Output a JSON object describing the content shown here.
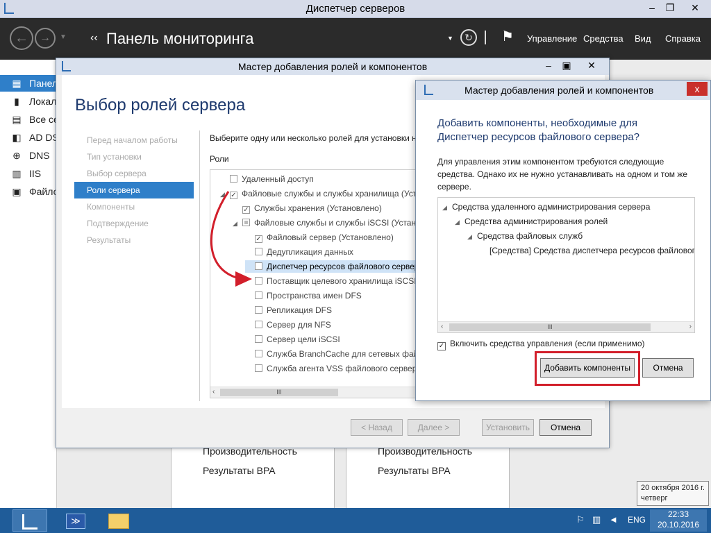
{
  "server_manager": {
    "title": "Диспетчер серверов",
    "header_title": "Панель мониторинга",
    "header_prefix": "‹‹",
    "menu": [
      "Управление",
      "Средства",
      "Вид",
      "Справка"
    ],
    "sidebar": [
      {
        "label": "Панель",
        "icon": "dashboard-icon",
        "glyph": "▦",
        "active": true
      },
      {
        "label": "Локал",
        "icon": "local-server-icon",
        "glyph": "▮"
      },
      {
        "label": "Все се",
        "icon": "all-servers-icon",
        "glyph": "▤"
      },
      {
        "label": "AD DS",
        "icon": "ad-ds-icon",
        "glyph": "◧"
      },
      {
        "label": "DNS",
        "icon": "dns-icon",
        "glyph": "⊕"
      },
      {
        "label": "IIS",
        "icon": "iis-icon",
        "glyph": "▥"
      },
      {
        "label": "Файло",
        "icon": "file-services-icon",
        "glyph": "▣"
      }
    ],
    "tiles": [
      {
        "performance": "Производительность",
        "bpa": "Результаты BPA"
      },
      {
        "performance": "Производительность",
        "bpa": "Результаты BPA"
      }
    ]
  },
  "wizard": {
    "title": "Мастер добавления ролей и компонентов",
    "heading": "Выбор ролей сервера",
    "steps": [
      {
        "label": "Перед началом работы",
        "active": false
      },
      {
        "label": "Тип установки",
        "active": false
      },
      {
        "label": "Выбор сервера",
        "active": false
      },
      {
        "label": "Роли сервера",
        "active": true
      },
      {
        "label": "Компоненты",
        "active": false
      },
      {
        "label": "Подтверждение",
        "active": false
      },
      {
        "label": "Результаты",
        "active": false
      }
    ],
    "description": "Выберите одну или несколько ролей для установки на",
    "roles_label": "Роли",
    "roles": [
      {
        "label": "Удаленный доступ",
        "checked": false,
        "indent": 0,
        "expand": ""
      },
      {
        "label": "Файловые службы и службы хранилища (Устан",
        "checked": true,
        "indent": 0,
        "expand": "◢"
      },
      {
        "label": "Службы хранения (Установлено)",
        "checked": true,
        "indent": 1,
        "expand": ""
      },
      {
        "label": "Файловые службы и службы iSCSI (Устан",
        "checked": "partial",
        "indent": 1,
        "expand": "◢"
      },
      {
        "label": "Файловый сервер (Установлено)",
        "checked": true,
        "indent": 2,
        "expand": ""
      },
      {
        "label": "Дедупликация данных",
        "checked": false,
        "indent": 2,
        "expand": ""
      },
      {
        "label": "Диспетчер ресурсов файлового сервер",
        "checked": false,
        "indent": 2,
        "expand": "",
        "highlight": true
      },
      {
        "label": "Поставщик целевого хранилища iSCSI (",
        "checked": false,
        "indent": 2,
        "expand": ""
      },
      {
        "label": "Пространства имен DFS",
        "checked": false,
        "indent": 2,
        "expand": ""
      },
      {
        "label": "Репликация DFS",
        "checked": false,
        "indent": 2,
        "expand": ""
      },
      {
        "label": "Сервер для NFS",
        "checked": false,
        "indent": 2,
        "expand": ""
      },
      {
        "label": "Сервер цели iSCSI",
        "checked": false,
        "indent": 2,
        "expand": ""
      },
      {
        "label": "Служба BranchCache для сетевых файло",
        "checked": false,
        "indent": 2,
        "expand": ""
      },
      {
        "label": "Служба агента VSS файлового сервера",
        "checked": false,
        "indent": 2,
        "expand": ""
      }
    ],
    "buttons": {
      "back": "< Назад",
      "next": "Далее >",
      "install": "Установить",
      "cancel": "Отмена"
    }
  },
  "dialog": {
    "title": "Мастер добавления ролей и компонентов",
    "close": "x",
    "heading": "Добавить компоненты, необходимые для Диспетчер ресурсов файлового сервера?",
    "description": "Для управления этим компонентом требуются следующие средства. Однако их не нужно устанавливать на одном и том же сервере.",
    "tree": [
      {
        "label": "Средства удаленного администрирования сервера",
        "indent": 0,
        "expand": "◢"
      },
      {
        "label": "Средства администрирования ролей",
        "indent": 1,
        "expand": "◢"
      },
      {
        "label": "Средства файловых служб",
        "indent": 2,
        "expand": "◢"
      },
      {
        "label": "[Средства] Средства диспетчера ресурсов файлового",
        "indent": 3,
        "expand": ""
      }
    ],
    "include_tools": "Включить средства управления (если применимо)",
    "include_checked": true,
    "add_button": "Добавить компоненты",
    "cancel_button": "Отмена"
  },
  "taskbar": {
    "language": "ENG",
    "time": "22:33",
    "date": "20.10.2016",
    "tooltip_date": "20 октября 2016 г.",
    "tooltip_day": "четверг"
  },
  "colors": {
    "accent": "#2f7fc9",
    "highlight_red": "#d21f2b",
    "taskbar": "#1f5c99"
  }
}
